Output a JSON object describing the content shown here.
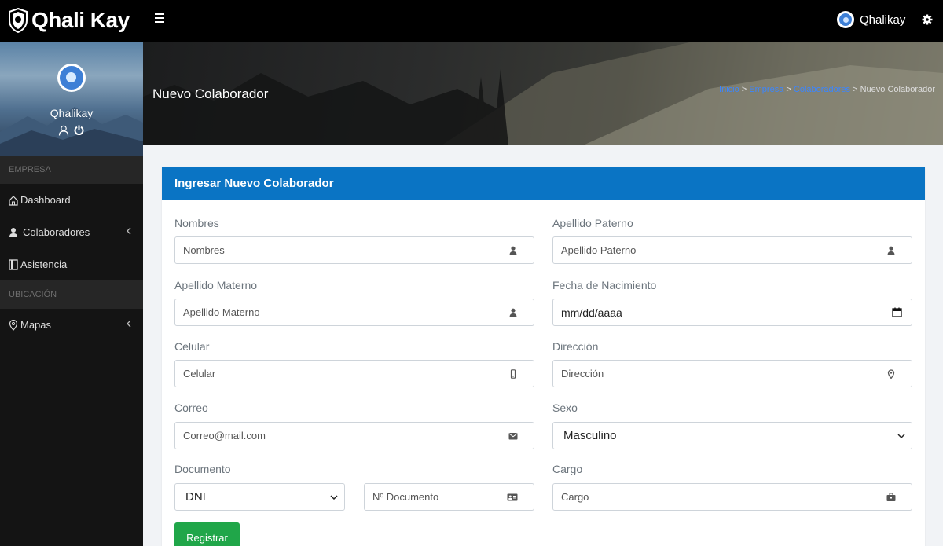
{
  "brand": {
    "name": "Qhali Kay"
  },
  "topbar": {
    "user_name": "Qhalikay"
  },
  "sidebar": {
    "profile_name": "Qhalikay",
    "sections": [
      {
        "label": "EMPRESA"
      },
      {
        "label": "UBICACIÓN"
      }
    ],
    "items": [
      {
        "label": "Dashboard"
      },
      {
        "label": "Colaboradores"
      },
      {
        "label": "Asistencia"
      },
      {
        "label": "Mapas"
      }
    ]
  },
  "header": {
    "title": "Nuevo Colaborador",
    "breadcrumb": [
      {
        "label": "Inicio"
      },
      {
        "label": "Empresa"
      },
      {
        "label": "Colaboradores"
      },
      {
        "label": "Nuevo Colaborador"
      }
    ],
    "separator": ">"
  },
  "form": {
    "title": "Ingresar Nuevo Colaborador",
    "nombres": {
      "label": "Nombres",
      "placeholder": "Nombres"
    },
    "apellido_paterno": {
      "label": "Apellido Paterno",
      "placeholder": "Apellido Paterno"
    },
    "apellido_materno": {
      "label": "Apellido Materno",
      "placeholder": "Apellido Materno"
    },
    "fecha_nacimiento": {
      "label": "Fecha de Nacimiento",
      "placeholder": "mm/dd/aaaa"
    },
    "celular": {
      "label": "Celular",
      "placeholder": "Celular"
    },
    "direccion": {
      "label": "Dirección",
      "placeholder": "Dirección"
    },
    "correo": {
      "label": "Correo",
      "placeholder": "Correo@mail.com"
    },
    "sexo": {
      "label": "Sexo",
      "value": "Masculino"
    },
    "documento": {
      "label": "Documento",
      "type_value": "DNI",
      "number_placeholder": "Nº Documento"
    },
    "cargo": {
      "label": "Cargo",
      "placeholder": "Cargo"
    },
    "submit_label": "Registrar"
  },
  "colors": {
    "topbar": "#000000",
    "sidebar": "#141414",
    "card_header": "#0a74c4",
    "submit": "#20a649",
    "link": "#3b86ff"
  }
}
